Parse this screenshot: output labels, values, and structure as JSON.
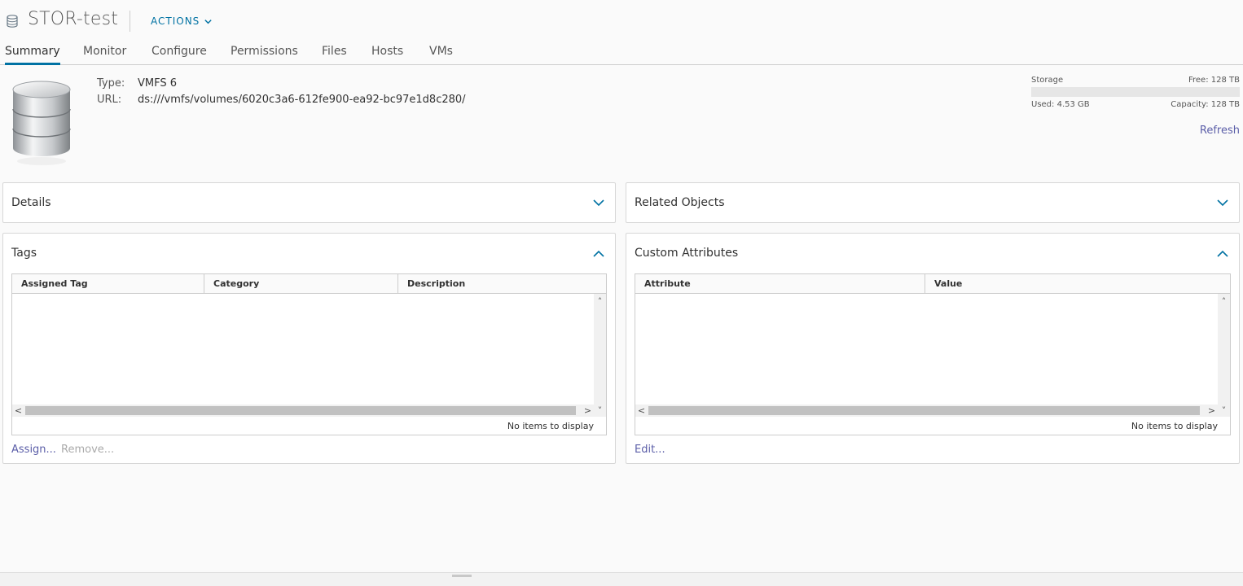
{
  "header": {
    "title": "STOR-test",
    "actions_label": "ACTIONS",
    "icon": "datastore-icon"
  },
  "tabs": [
    {
      "label": "Summary",
      "active": true
    },
    {
      "label": "Monitor"
    },
    {
      "label": "Configure"
    },
    {
      "label": "Permissions"
    },
    {
      "label": "Files"
    },
    {
      "label": "Hosts"
    },
    {
      "label": "VMs"
    }
  ],
  "summary": {
    "type_label": "Type:",
    "type_value": "VMFS 6",
    "url_label": "URL:",
    "url_value": "ds:///vmfs/volumes/6020c3a6-612fe900-ea92-bc97e1d8c280/"
  },
  "storage": {
    "label": "Storage",
    "free": "Free: 128 TB",
    "used": "Used: 4.53 GB",
    "capacity": "Capacity: 128 TB",
    "used_fraction": 0.0,
    "refresh": "Refresh"
  },
  "panels": {
    "details": {
      "title": "Details"
    },
    "related": {
      "title": "Related Objects"
    },
    "tags": {
      "title": "Tags",
      "columns": [
        "Assigned Tag",
        "Category",
        "Description"
      ],
      "empty_text": "No items to display",
      "assign": "Assign...",
      "remove": "Remove..."
    },
    "custom": {
      "title": "Custom Attributes",
      "columns": [
        "Attribute",
        "Value"
      ],
      "empty_text": "No items to display",
      "edit": "Edit..."
    }
  },
  "colors": {
    "accent": "#0072a3",
    "link": "#5b5ea8"
  }
}
